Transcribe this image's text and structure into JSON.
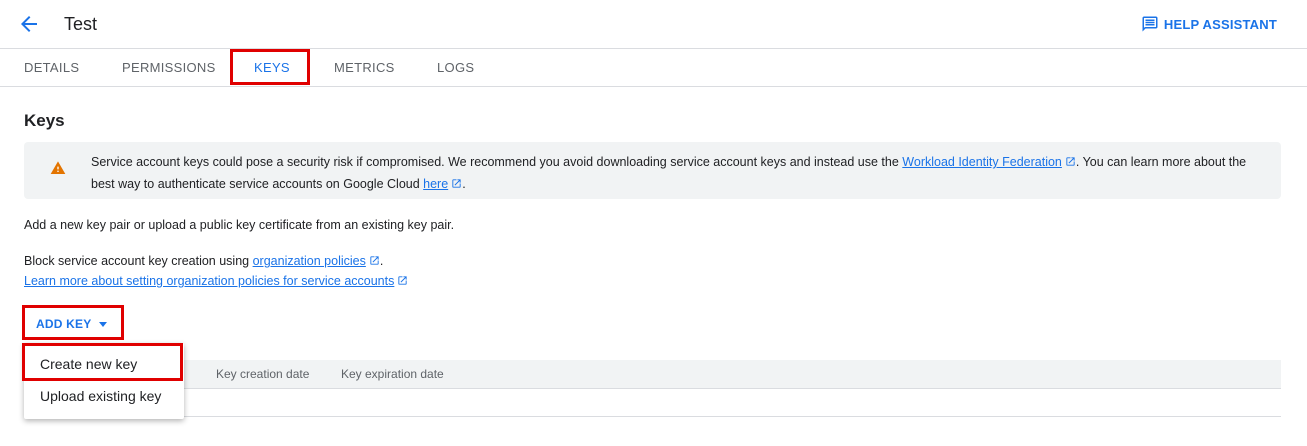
{
  "header": {
    "title": "Test",
    "help_label": "HELP ASSISTANT"
  },
  "tabs": [
    {
      "label": "DETAILS"
    },
    {
      "label": "PERMISSIONS"
    },
    {
      "label": "KEYS"
    },
    {
      "label": "METRICS"
    },
    {
      "label": "LOGS"
    }
  ],
  "active_tab": "KEYS",
  "section": {
    "title": "Keys",
    "warning": {
      "text1": "Service account keys could pose a security risk if compromised. We recommend you avoid downloading service account keys and instead use the ",
      "link1": "Workload Identity Federation",
      "text2": ". You can learn more about the best way to authenticate service accounts on Google Cloud ",
      "link2": "here",
      "text3": "."
    },
    "add_pair_text": "Add a new key pair or upload a public key certificate from an existing key pair.",
    "block_text": "Block service account key creation using ",
    "block_link": "organization policies",
    "block_end": ".",
    "learn_link": "Learn more about setting organization policies for service accounts"
  },
  "add_key": {
    "label": "ADD KEY",
    "menu": [
      {
        "label": "Create new key"
      },
      {
        "label": "Upload existing key"
      }
    ]
  },
  "table": {
    "columns": [
      "Key creation date",
      "Key expiration date"
    ]
  },
  "colors": {
    "accent": "#1a73e8",
    "warning": "#e37400",
    "highlight": "#e00000"
  }
}
